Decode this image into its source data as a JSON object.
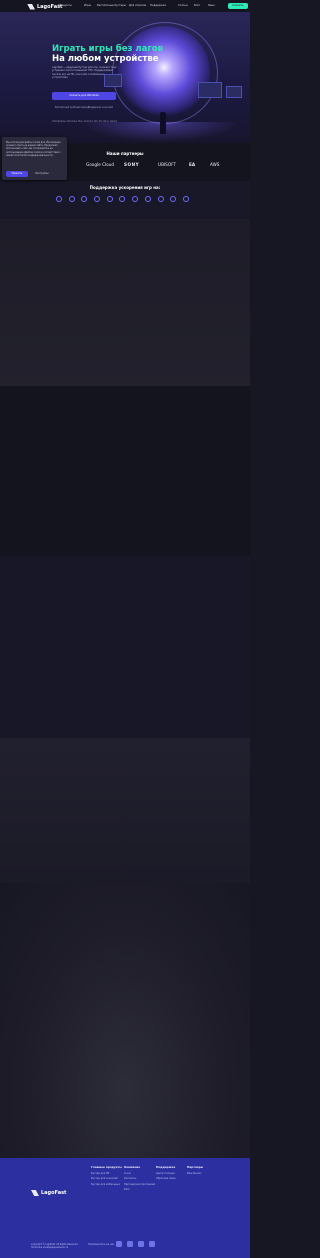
{
  "header": {
    "logo_text": "LagoFast",
    "nav": [
      "Продукты",
      "Игры",
      "Бесплатные бустеры",
      "Для игроков",
      "Поддержка",
      "Статьи",
      "Блог",
      "Язык"
    ],
    "cta_label": "Скачать"
  },
  "hero": {
    "title_line1": "Играть игры без лагов",
    "title_line2": "На любом устройстве",
    "description": "LagoFast — ведущий бустер для игр, снижает пинг, устраняет лаги и повышает FPS. Поддерживает тысячи игр на ПК, консолях и мобильных устройствах.",
    "download_label": "Скачать для Windows",
    "sub_links": [
      "Бесплатный пробный период",
      "Поддержка консолей"
    ],
    "platforms_label": "Платформы: Windows, Mac, Android, iOS, PS, Xbox, Switch"
  },
  "cookie": {
    "text": "Мы используем файлы cookie для обеспечения лучшего опыта на нашем сайте. Продолжая использовать сайт, вы соглашаетесь на использование файлов cookie в соответствии с нашей политикой конфиденциальности.",
    "accept_label": "Принять",
    "settings_label": "Настройки"
  },
  "partners": {
    "title": "Наши партнеры",
    "items": [
      "Google Cloud",
      "SONY",
      "UBISOFT",
      "EA",
      "AWS"
    ]
  },
  "games": {
    "title": "Поддержка ускорения игр на:",
    "platform_icons": [
      "windows-icon",
      "mac-icon",
      "android-icon",
      "apple-icon",
      "playstation-icon",
      "xbox-icon",
      "switch-icon",
      "mobile-icon",
      "steam-icon",
      "router-icon",
      "console-icon"
    ]
  },
  "footer": {
    "logo_text": "LagoFast",
    "columns": [
      {
        "head": "Главные продукты",
        "items": [
          "Бустер для ПК",
          "Бустер для консолей",
          "Бустер для мобильных"
        ]
      },
      {
        "head": "Компания",
        "items": [
          "О нас",
          "Контакты",
          "Партнерская программа",
          "Блог"
        ]
      },
      {
        "head": "Поддержка",
        "items": [
          "Центр помощи",
          "Обратная связь"
        ]
      },
      {
        "head": "Партнеры",
        "items": [
          "Ваш бизнес"
        ]
      }
    ],
    "copyright_line1": "Copyright © LagoFast. All Rights Reserved.",
    "copyright_line2": "Политика конфиденциальности",
    "social_label": "Подпишитесь на нас",
    "social_icons": [
      "discord-icon",
      "youtube-icon",
      "twitter-icon",
      "instagram-icon"
    ]
  },
  "colors": {
    "accent_green": "#2ee8b6",
    "primary_blue": "#4f46e5",
    "footer_blue": "#2b2fa0",
    "background": "#171723"
  }
}
